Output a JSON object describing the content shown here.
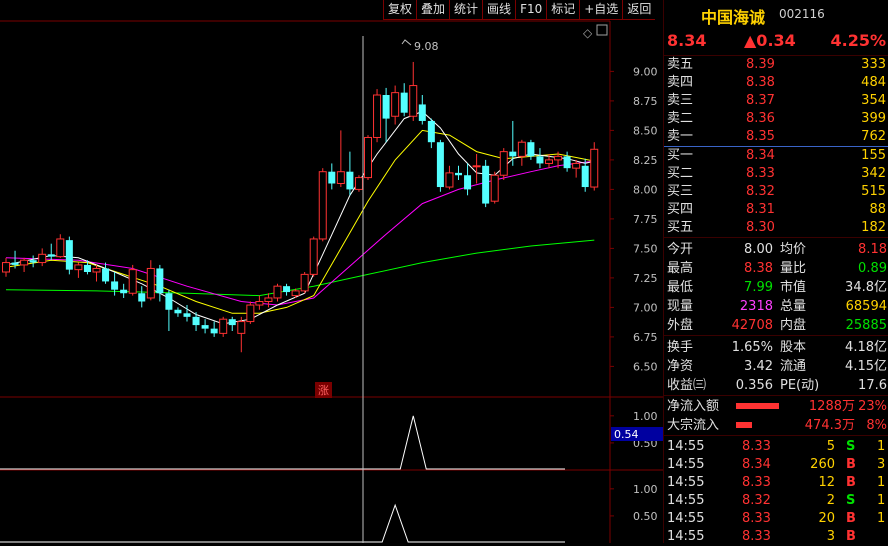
{
  "toolbar": [
    "复权",
    "叠加",
    "统计",
    "画线",
    "F10",
    "标记",
    "+自选",
    "返回"
  ],
  "chart": {
    "high_label": "9.08",
    "zhang_label": "涨",
    "y_ticks": [
      "9.00",
      "8.75",
      "8.50",
      "8.25",
      "8.00",
      "7.75",
      "7.50",
      "7.25",
      "7.00",
      "6.75",
      "6.50"
    ],
    "ind1_ticks": [
      "1.00",
      "0.50"
    ],
    "ind1_value": "0.54",
    "ind2_ticks": [
      "1.00",
      "0.50"
    ]
  },
  "colors": {
    "up": "#ff3232",
    "down": "#54ffff",
    "ma5": "#ffffff",
    "ma10": "#ffff00",
    "ma20": "#ff00ff",
    "ma60": "#00ff00",
    "text": "#e0e0e0",
    "price": "#ff3232",
    "vol": "#ffd200"
  },
  "chart_data": {
    "type": "candlestick",
    "ylim": [
      6.3,
      9.3
    ],
    "candles": [
      [
        7.3,
        7.42,
        7.26,
        7.38
      ],
      [
        7.38,
        7.48,
        7.33,
        7.36
      ],
      [
        7.36,
        7.42,
        7.3,
        7.4
      ],
      [
        7.4,
        7.44,
        7.34,
        7.38
      ],
      [
        7.38,
        7.5,
        7.35,
        7.45
      ],
      [
        7.45,
        7.54,
        7.4,
        7.43
      ],
      [
        7.43,
        7.62,
        7.42,
        7.58
      ],
      [
        7.57,
        7.6,
        7.28,
        7.32
      ],
      [
        7.32,
        7.38,
        7.25,
        7.36
      ],
      [
        7.36,
        7.4,
        7.28,
        7.3
      ],
      [
        7.3,
        7.36,
        7.22,
        7.33
      ],
      [
        7.33,
        7.38,
        7.2,
        7.22
      ],
      [
        7.22,
        7.3,
        7.1,
        7.15
      ],
      [
        7.15,
        7.2,
        7.08,
        7.12
      ],
      [
        7.12,
        7.36,
        7.1,
        7.32
      ],
      [
        7.12,
        7.18,
        7.0,
        7.05
      ],
      [
        7.08,
        7.4,
        7.06,
        7.33
      ],
      [
        7.33,
        7.36,
        7.05,
        7.12
      ],
      [
        7.12,
        7.15,
        6.8,
        6.98
      ],
      [
        6.98,
        7.0,
        6.92,
        6.95
      ],
      [
        6.95,
        7.02,
        6.88,
        6.92
      ],
      [
        6.92,
        6.96,
        6.8,
        6.85
      ],
      [
        6.85,
        6.9,
        6.78,
        6.82
      ],
      [
        6.82,
        6.88,
        6.75,
        6.78
      ],
      [
        6.78,
        6.92,
        6.75,
        6.9
      ],
      [
        6.9,
        6.92,
        6.8,
        6.85
      ],
      [
        6.78,
        6.92,
        6.62,
        6.88
      ],
      [
        6.88,
        7.05,
        6.86,
        7.02
      ],
      [
        7.02,
        7.1,
        6.98,
        7.05
      ],
      [
        7.05,
        7.12,
        7.0,
        7.08
      ],
      [
        7.08,
        7.2,
        7.05,
        7.18
      ],
      [
        7.18,
        7.2,
        7.1,
        7.13
      ],
      [
        7.1,
        7.16,
        7.08,
        7.14
      ],
      [
        7.14,
        7.3,
        7.12,
        7.28
      ],
      [
        7.28,
        7.6,
        7.26,
        7.58
      ],
      [
        7.58,
        8.18,
        7.56,
        8.15
      ],
      [
        8.15,
        8.22,
        8.0,
        8.05
      ],
      [
        8.05,
        8.5,
        8.02,
        8.15
      ],
      [
        8.15,
        8.32,
        7.95,
        8.0
      ],
      [
        8.0,
        8.12,
        7.98,
        8.1
      ],
      [
        8.1,
        8.46,
        8.08,
        8.44
      ],
      [
        8.44,
        8.85,
        8.4,
        8.8
      ],
      [
        8.8,
        8.86,
        8.4,
        8.6
      ],
      [
        8.62,
        8.88,
        8.55,
        8.82
      ],
      [
        8.82,
        8.9,
        8.62,
        8.65
      ],
      [
        8.62,
        9.08,
        8.58,
        8.88
      ],
      [
        8.72,
        8.8,
        8.55,
        8.58
      ],
      [
        8.58,
        8.6,
        8.35,
        8.4
      ],
      [
        8.4,
        8.42,
        7.98,
        8.02
      ],
      [
        8.02,
        8.2,
        8.0,
        8.14
      ],
      [
        8.14,
        8.2,
        8.08,
        8.12
      ],
      [
        8.12,
        8.22,
        7.95,
        8.0
      ],
      [
        8.2,
        8.3,
        8.05,
        8.2
      ],
      [
        8.2,
        8.25,
        7.85,
        7.88
      ],
      [
        7.9,
        8.15,
        7.88,
        8.12
      ],
      [
        8.12,
        8.35,
        8.08,
        8.32
      ],
      [
        8.32,
        8.58,
        8.2,
        8.28
      ],
      [
        8.28,
        8.42,
        8.2,
        8.4
      ],
      [
        8.4,
        8.42,
        8.25,
        8.28
      ],
      [
        8.28,
        8.35,
        8.18,
        8.22
      ],
      [
        8.22,
        8.3,
        8.18,
        8.25
      ],
      [
        8.25,
        8.32,
        8.18,
        8.28
      ],
      [
        8.28,
        8.32,
        8.15,
        8.18
      ],
      [
        8.18,
        8.25,
        8.1,
        8.22
      ],
      [
        8.2,
        8.26,
        7.98,
        8.02
      ],
      [
        8.02,
        8.4,
        7.99,
        8.34
      ]
    ],
    "ma": {
      "ma5": [
        [
          0,
          7.36
        ],
        [
          5,
          7.44
        ],
        [
          8,
          7.42
        ],
        [
          12,
          7.3
        ],
        [
          15,
          7.2
        ],
        [
          18,
          7.08
        ],
        [
          21,
          6.94
        ],
        [
          24,
          6.86
        ],
        [
          27,
          6.9
        ],
        [
          30,
          7.02
        ],
        [
          33,
          7.12
        ],
        [
          35,
          7.45
        ],
        [
          38,
          7.95
        ],
        [
          41,
          8.3
        ],
        [
          44,
          8.6
        ],
        [
          46,
          8.66
        ],
        [
          48,
          8.52
        ],
        [
          50,
          8.3
        ],
        [
          52,
          8.14
        ],
        [
          54,
          8.12
        ],
        [
          56,
          8.26
        ],
        [
          58,
          8.3
        ],
        [
          60,
          8.28
        ],
        [
          62,
          8.26
        ],
        [
          64,
          8.22
        ],
        [
          65,
          8.24
        ]
      ],
      "ma10": [
        [
          0,
          7.34
        ],
        [
          5,
          7.4
        ],
        [
          9,
          7.38
        ],
        [
          13,
          7.28
        ],
        [
          17,
          7.18
        ],
        [
          21,
          7.05
        ],
        [
          25,
          6.95
        ],
        [
          28,
          6.95
        ],
        [
          31,
          7.0
        ],
        [
          34,
          7.1
        ],
        [
          37,
          7.5
        ],
        [
          40,
          7.9
        ],
        [
          43,
          8.25
        ],
        [
          46,
          8.5
        ],
        [
          49,
          8.46
        ],
        [
          52,
          8.32
        ],
        [
          55,
          8.26
        ],
        [
          58,
          8.28
        ],
        [
          61,
          8.3
        ],
        [
          63,
          8.27
        ],
        [
          65,
          8.24
        ]
      ],
      "ma20": [
        [
          0,
          7.42
        ],
        [
          8,
          7.4
        ],
        [
          14,
          7.33
        ],
        [
          20,
          7.18
        ],
        [
          26,
          7.05
        ],
        [
          30,
          7.02
        ],
        [
          34,
          7.08
        ],
        [
          38,
          7.35
        ],
        [
          42,
          7.62
        ],
        [
          46,
          7.88
        ],
        [
          50,
          8.0
        ],
        [
          54,
          8.08
        ],
        [
          58,
          8.15
        ],
        [
          61,
          8.2
        ],
        [
          63,
          8.22
        ],
        [
          65,
          8.24
        ]
      ],
      "ma60": [
        [
          0,
          7.15
        ],
        [
          10,
          7.14
        ],
        [
          20,
          7.12
        ],
        [
          28,
          7.1
        ],
        [
          34,
          7.18
        ],
        [
          40,
          7.28
        ],
        [
          46,
          7.38
        ],
        [
          52,
          7.46
        ],
        [
          58,
          7.52
        ],
        [
          65,
          7.57
        ]
      ]
    },
    "indicator1": {
      "ylim": [
        0,
        1.2
      ],
      "peak_index": 45,
      "peak": 1.0
    },
    "indicator2": {
      "ylim": [
        0,
        1.2
      ],
      "peak_index": 43,
      "peak": 0.7
    }
  },
  "quote": {
    "name": "中国海诚",
    "code": "002116",
    "price": "8.34",
    "change": "▲0.34",
    "pct": "4.25%",
    "asks": [
      {
        "label": "卖五",
        "price": "8.39",
        "vol": "333"
      },
      {
        "label": "卖四",
        "price": "8.38",
        "vol": "484"
      },
      {
        "label": "卖三",
        "price": "8.37",
        "vol": "354"
      },
      {
        "label": "卖二",
        "price": "8.36",
        "vol": "399"
      },
      {
        "label": "卖一",
        "price": "8.35",
        "vol": "762"
      }
    ],
    "bids": [
      {
        "label": "买一",
        "price": "8.34",
        "vol": "155"
      },
      {
        "label": "买二",
        "price": "8.33",
        "vol": "342"
      },
      {
        "label": "买三",
        "price": "8.32",
        "vol": "515"
      },
      {
        "label": "买四",
        "price": "8.31",
        "vol": "88"
      },
      {
        "label": "买五",
        "price": "8.30",
        "vol": "182"
      }
    ],
    "stats": [
      {
        "k1": "今开",
        "v1": "8.00",
        "c1": "#e0e0e0",
        "k2": "均价",
        "v2": "8.18",
        "c2": "#ff3232"
      },
      {
        "k1": "最高",
        "v1": "8.38",
        "c1": "#ff3232",
        "k2": "量比",
        "v2": "0.89",
        "c2": "#00e000"
      },
      {
        "k1": "最低",
        "v1": "7.99",
        "c1": "#00e000",
        "k2": "市值",
        "v2": "34.8亿",
        "c2": "#e0e0e0"
      },
      {
        "k1": "现量",
        "v1": "2318",
        "c1": "#ff40ff",
        "k2": "总量",
        "v2": "68594",
        "c2": "#ffd200"
      },
      {
        "k1": "外盘",
        "v1": "42708",
        "c1": "#ff3232",
        "k2": "内盘",
        "v2": "25885",
        "c2": "#00e000"
      }
    ],
    "stats2": [
      {
        "k1": "换手",
        "v1": "1.65%",
        "c1": "#e0e0e0",
        "k2": "股本",
        "v2": "4.18亿",
        "c2": "#e0e0e0"
      },
      {
        "k1": "净资",
        "v1": "3.42",
        "c1": "#e0e0e0",
        "k2": "流通",
        "v2": "4.15亿",
        "c2": "#e0e0e0"
      },
      {
        "k1": "收益㈢",
        "v1": "0.356",
        "c1": "#e0e0e0",
        "k2": "PE(动)",
        "v2": "17.6",
        "c2": "#e0e0e0"
      }
    ],
    "flows": [
      {
        "label": "净流入额",
        "bar": 0.65,
        "value": "1288万",
        "pct": "23%"
      },
      {
        "label": "大宗流入",
        "bar": 0.24,
        "value": "474.3万",
        "pct": "8%"
      }
    ],
    "ticks": [
      {
        "time": "14:55",
        "price": "8.33",
        "vol": "5",
        "side": "S",
        "extra": "1"
      },
      {
        "time": "14:55",
        "price": "8.34",
        "vol": "260",
        "side": "B",
        "extra": "3"
      },
      {
        "time": "14:55",
        "price": "8.33",
        "vol": "12",
        "side": "B",
        "extra": "1"
      },
      {
        "time": "14:55",
        "price": "8.32",
        "vol": "2",
        "side": "S",
        "extra": "1"
      },
      {
        "time": "14:55",
        "price": "8.33",
        "vol": "20",
        "side": "B",
        "extra": "1"
      },
      {
        "time": "14:55",
        "price": "8.33",
        "vol": "3",
        "side": "B",
        "extra": ""
      }
    ]
  }
}
